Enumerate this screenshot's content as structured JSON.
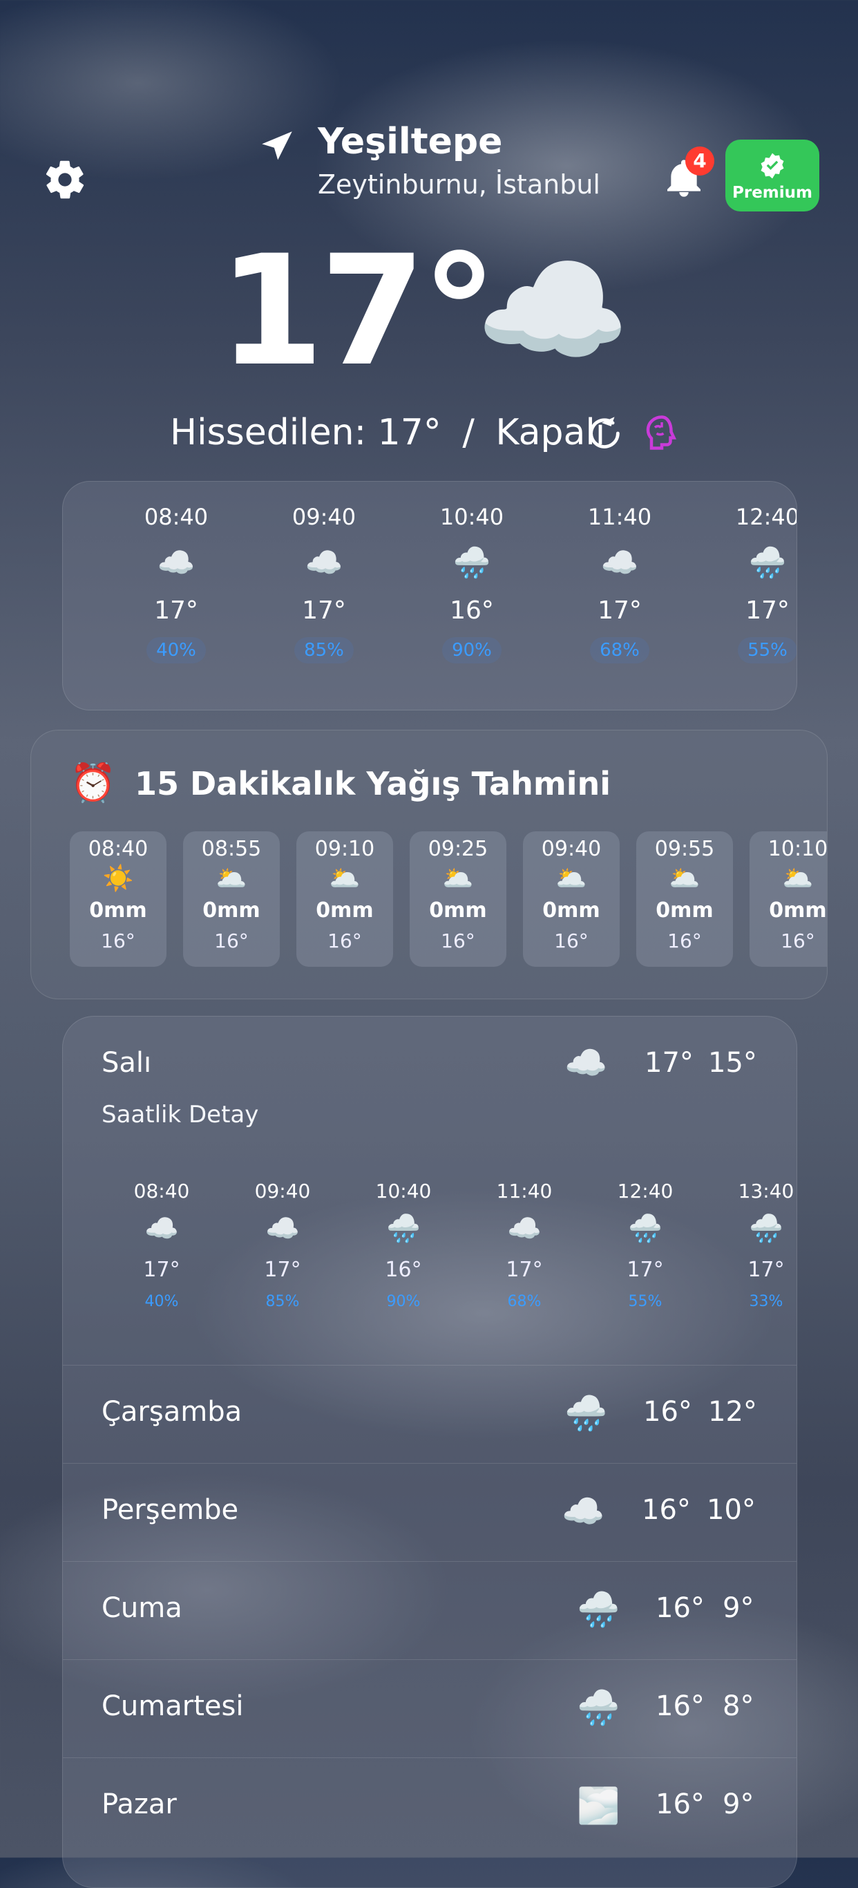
{
  "header": {
    "location_name": "Yeşiltepe",
    "location_sub": "Zeytinburnu, İstanbul",
    "notification_count": "4",
    "premium_label": "Premium",
    "settings_icon": "gear-icon",
    "location_icon": "location-arrow-icon",
    "bell_icon": "bell-icon"
  },
  "current": {
    "temperature": "17°",
    "icon": "☁️",
    "feels_like": "Hissedilen: 17°",
    "separator": "/",
    "condition": "Kapalı",
    "refresh_icon": "refresh-icon",
    "ai_icon": "brain-icon"
  },
  "hourly": [
    {
      "time": "08:40",
      "icon": "☁️",
      "temp": "17°",
      "pct": "40%"
    },
    {
      "time": "09:40",
      "icon": "☁️",
      "temp": "17°",
      "pct": "85%"
    },
    {
      "time": "10:40",
      "icon": "🌧️",
      "temp": "16°",
      "pct": "90%"
    },
    {
      "time": "11:40",
      "icon": "☁️",
      "temp": "17°",
      "pct": "68%"
    },
    {
      "time": "12:40",
      "icon": "🌧️",
      "temp": "17°",
      "pct": "55%"
    }
  ],
  "precip": {
    "title": "15 Dakikalık Yağış Tahmini",
    "icon": "⏰",
    "items": [
      {
        "time": "08:40",
        "icon": "☀️",
        "mm": "0mm",
        "temp": "16°"
      },
      {
        "time": "08:55",
        "icon": "🌥️",
        "mm": "0mm",
        "temp": "16°"
      },
      {
        "time": "09:10",
        "icon": "🌥️",
        "mm": "0mm",
        "temp": "16°"
      },
      {
        "time": "09:25",
        "icon": "🌥️",
        "mm": "0mm",
        "temp": "16°"
      },
      {
        "time": "09:40",
        "icon": "🌥️",
        "mm": "0mm",
        "temp": "16°"
      },
      {
        "time": "09:55",
        "icon": "🌥️",
        "mm": "0mm",
        "temp": "16°"
      },
      {
        "time": "10:10",
        "icon": "🌥️",
        "mm": "0mm",
        "temp": "16°"
      }
    ]
  },
  "daily": {
    "today": {
      "day": "Salı",
      "icon": "☁️",
      "hi": "17°",
      "lo": "15°",
      "detail_label": "Saatlik Detay"
    },
    "detail_hours": [
      {
        "time": "08:40",
        "icon": "☁️",
        "temp": "17°",
        "pct": "40%"
      },
      {
        "time": "09:40",
        "icon": "☁️",
        "temp": "17°",
        "pct": "85%"
      },
      {
        "time": "10:40",
        "icon": "🌧️",
        "temp": "16°",
        "pct": "90%"
      },
      {
        "time": "11:40",
        "icon": "☁️",
        "temp": "17°",
        "pct": "68%"
      },
      {
        "time": "12:40",
        "icon": "🌧️",
        "temp": "17°",
        "pct": "55%"
      },
      {
        "time": "13:40",
        "icon": "🌧️",
        "temp": "17°",
        "pct": "33%"
      }
    ],
    "days": [
      {
        "day": "Çarşamba",
        "icon": "🌧️",
        "hi": "16°",
        "lo": "12°"
      },
      {
        "day": "Perşembe",
        "icon": "☁️",
        "hi": "16°",
        "lo": "10°"
      },
      {
        "day": "Cuma",
        "icon": "🌧️",
        "hi": "16°",
        "lo": "9°"
      },
      {
        "day": "Cumartesi",
        "icon": "🌧️",
        "hi": "16°",
        "lo": "8°"
      },
      {
        "day": "Pazar",
        "icon": "🌫️",
        "hi": "16°",
        "lo": "9°"
      }
    ]
  },
  "colors": {
    "accent_blue": "#3b9cff",
    "premium_green": "#34c759",
    "badge_red": "#ff3b30",
    "ai_purple": "#c93bd9"
  }
}
